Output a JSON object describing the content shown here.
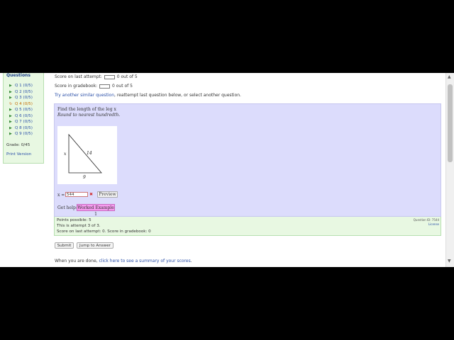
{
  "sidebar": {
    "title": "Questions",
    "questions": [
      {
        "label": "Q 1 (0/5)",
        "current": false
      },
      {
        "label": "Q 2 (0/5)",
        "current": false
      },
      {
        "label": "Q 3 (0/5)",
        "current": false
      },
      {
        "label": "Q 4 (0/5)",
        "current": true
      },
      {
        "label": "Q 5 (0/5)",
        "current": false
      },
      {
        "label": "Q 6 (0/5)",
        "current": false
      },
      {
        "label": "Q 7 (0/5)",
        "current": false
      },
      {
        "label": "Q 8 (0/5)",
        "current": false
      },
      {
        "label": "Q 9 (0/5)",
        "current": false
      }
    ],
    "grade": "Grade: 0/45",
    "print_version": "Print Version"
  },
  "scores": {
    "last_attempt_label": "Score on last attempt:",
    "last_attempt_suffix": "0 out of 5",
    "gradebook_label": "Score in gradebook:",
    "gradebook_suffix": "0 out of 5"
  },
  "similar": {
    "link": "Try another similar question",
    "rest": ", reattempt last question below, or select another question."
  },
  "question": {
    "text": "Find the length of the leg x",
    "instruction": "Round to nearest hundredth.",
    "figure": {
      "label_x": "x",
      "label_hyp": "14",
      "label_base": "9"
    }
  },
  "answer": {
    "label": "x =",
    "value": "544",
    "incorrect_mark": "✖",
    "preview_label": "Preview"
  },
  "help": {
    "label": "Get help:",
    "worked_example": "Worked Example 1"
  },
  "info": {
    "points_possible": "Points possible: 5",
    "attempt": "This is attempt 3 of 3.",
    "summary": "Score on last attempt: 0. Score in gradebook: 0",
    "question_id": "Question ID: 7544",
    "license": "License"
  },
  "buttons": {
    "submit": "Submit",
    "jump": "Jump to Answer"
  },
  "footer": {
    "prefix": "When you are done,",
    "link": "click here to see a summary of your scores",
    "suffix": "."
  },
  "colors": {
    "question_panel": "#dcdcfc",
    "info_panel": "#e8f8e2",
    "link": "#2a4fa8",
    "worked_example": "#f79cf0"
  }
}
